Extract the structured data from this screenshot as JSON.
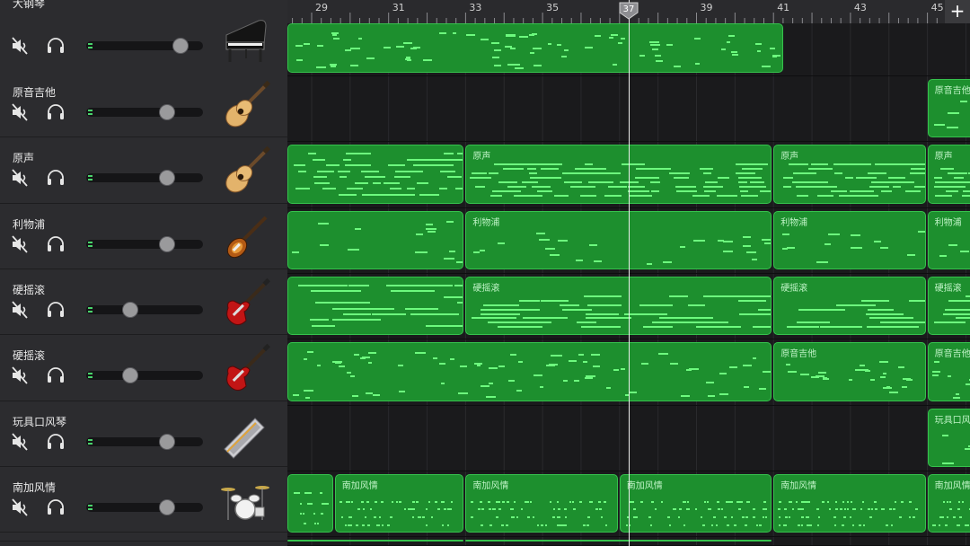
{
  "timeline": {
    "bars": [
      "29",
      "31",
      "33",
      "35",
      "37",
      "39",
      "41",
      "43",
      "45"
    ],
    "current_bar": "37",
    "add_track_label": "+"
  },
  "tracks": [
    {
      "name": "大钢琴",
      "instrument_icon": "grand-piano-icon",
      "volume": 0.81,
      "regions": [
        {
          "label": "",
          "start": 29,
          "end": 41.3,
          "density": "mid"
        }
      ]
    },
    {
      "name": "原音吉他",
      "instrument_icon": "acoustic-guitar-icon",
      "volume": 0.69,
      "regions": [
        {
          "label": "原音吉他",
          "start": 45,
          "end": 47,
          "density": "sparse"
        }
      ]
    },
    {
      "name": "原声",
      "instrument_icon": "acoustic-guitar-icon",
      "volume": 0.69,
      "regions": [
        {
          "label": "",
          "start": 29,
          "end": 33,
          "density": "dense"
        },
        {
          "label": "原声",
          "start": 33,
          "end": 41,
          "density": "dense"
        },
        {
          "label": "原声",
          "start": 41,
          "end": 45,
          "density": "dense"
        },
        {
          "label": "原声",
          "start": 45,
          "end": 47,
          "density": "dense"
        }
      ]
    },
    {
      "name": "利物浦",
      "instrument_icon": "violin-bass-icon",
      "volume": 0.69,
      "regions": [
        {
          "label": "",
          "start": 29,
          "end": 33,
          "density": "sparse"
        },
        {
          "label": "利物浦",
          "start": 33,
          "end": 41,
          "density": "sparse"
        },
        {
          "label": "利物浦",
          "start": 41,
          "end": 45,
          "density": "sparse"
        },
        {
          "label": "利物浦",
          "start": 45,
          "end": 47,
          "density": "sparse"
        }
      ]
    },
    {
      "name": "硬摇滚",
      "instrument_icon": "electric-guitar-icon",
      "volume": 0.38,
      "regions": [
        {
          "label": "",
          "start": 29,
          "end": 33,
          "density": "long"
        },
        {
          "label": "硬摇滚",
          "start": 33,
          "end": 41,
          "density": "long"
        },
        {
          "label": "硬摇滚",
          "start": 41,
          "end": 45,
          "density": "long"
        },
        {
          "label": "硬摇滚",
          "start": 45,
          "end": 47,
          "density": "long"
        }
      ]
    },
    {
      "name": "硬摇滚",
      "instrument_icon": "electric-guitar-icon",
      "volume": 0.38,
      "regions": [
        {
          "label": "",
          "start": 29,
          "end": 41,
          "density": "mid"
        },
        {
          "label": "原音吉他",
          "start": 41,
          "end": 45,
          "density": "mid"
        },
        {
          "label": "原音吉他",
          "start": 45,
          "end": 47,
          "density": "mid"
        }
      ]
    },
    {
      "name": "玩具口风琴",
      "instrument_icon": "harmonica-icon",
      "volume": 0.69,
      "regions": [
        {
          "label": "玩具口风",
          "start": 45,
          "end": 47,
          "density": "sparse"
        }
      ]
    },
    {
      "name": "南加风情",
      "instrument_icon": "drum-kit-icon",
      "volume": 0.69,
      "regions": [
        {
          "label": "",
          "start": 29,
          "end": 29.6,
          "density": "drum"
        },
        {
          "label": "南加风情",
          "start": 29.6,
          "end": 33,
          "density": "drum"
        },
        {
          "label": "南加风情",
          "start": 33,
          "end": 37,
          "density": "drum"
        },
        {
          "label": "南加风情",
          "start": 37,
          "end": 41,
          "density": "drum"
        },
        {
          "label": "南加风情",
          "start": 41,
          "end": 45,
          "density": "drum"
        },
        {
          "label": "南加风情",
          "start": 45,
          "end": 47,
          "density": "drum"
        }
      ]
    },
    {
      "name": "",
      "instrument_icon": "",
      "volume": null,
      "regions": [
        {
          "label": "",
          "start": 29,
          "end": 33,
          "density": "none"
        },
        {
          "label": "",
          "start": 33,
          "end": 41,
          "density": "none"
        }
      ]
    }
  ]
}
